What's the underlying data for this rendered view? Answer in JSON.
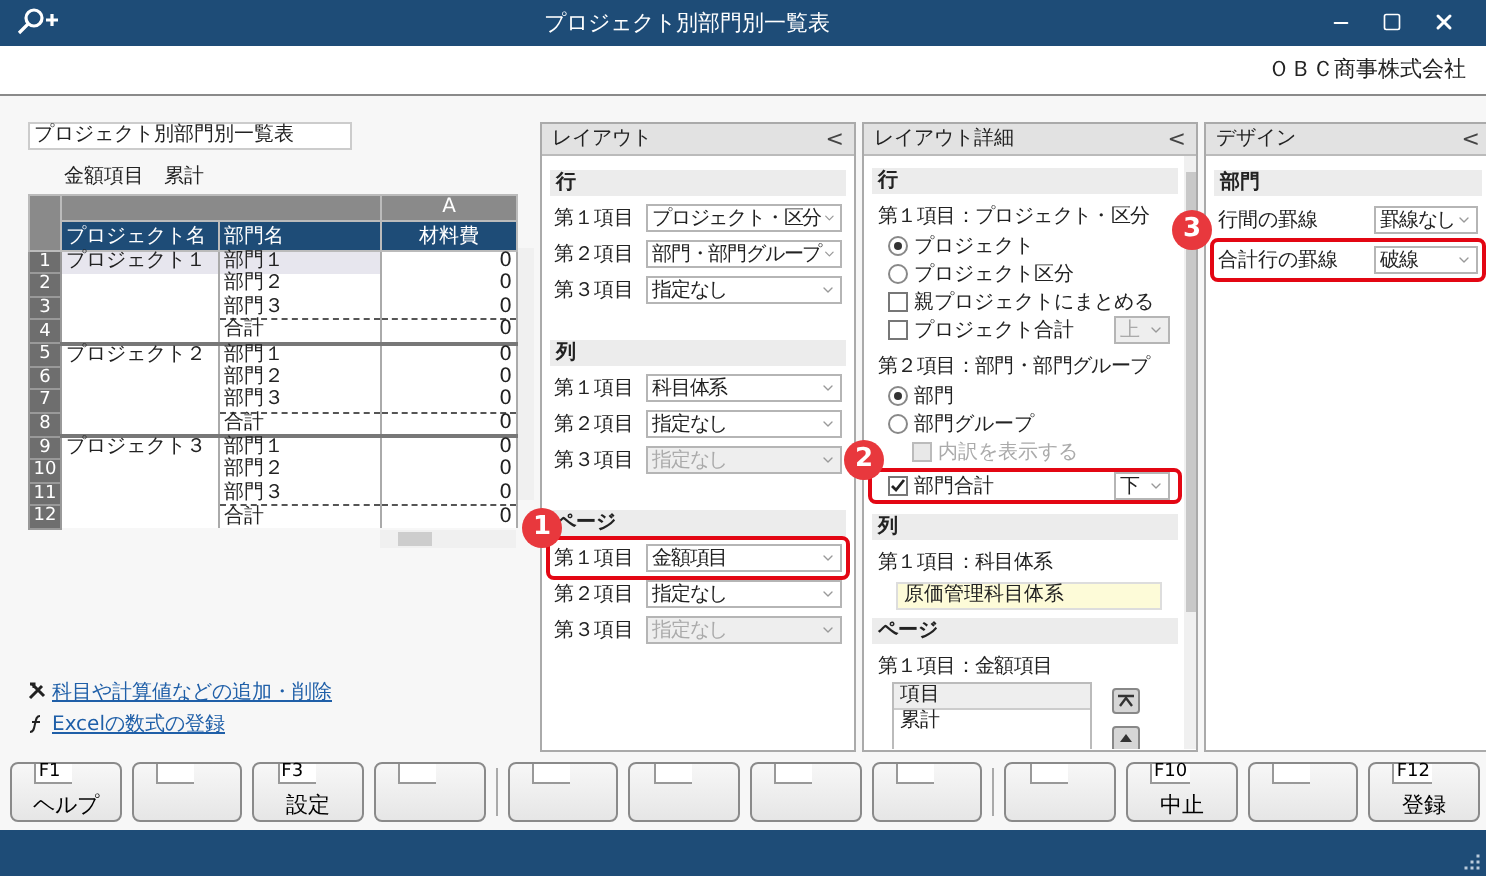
{
  "window": {
    "title": "プロジェクト別部門別一覧表",
    "company": "ＯＢＣ商事株式会社"
  },
  "report": {
    "title": "プロジェクト別部門別一覧表",
    "page_item": "金額項目",
    "page_value": "累計",
    "column_letter": "A",
    "columns": [
      "プロジェクト名",
      "部門名",
      "材料費"
    ],
    "rows": [
      {
        "number": "1",
        "project": "プロジェクト１",
        "department": "部門１",
        "amount": "0",
        "kind": "detail",
        "selected": true
      },
      {
        "number": "2",
        "department": "部門２",
        "amount": "0",
        "kind": "detail",
        "selected": false
      },
      {
        "number": "3",
        "department": "部門３",
        "amount": "0",
        "kind": "detail",
        "selected": false
      },
      {
        "number": "4",
        "department": "合計",
        "amount": "0",
        "kind": "total",
        "selected": false
      },
      {
        "number": "5",
        "project": "プロジェクト２",
        "department": "部門１",
        "amount": "0",
        "kind": "detail",
        "selected": false
      },
      {
        "number": "6",
        "department": "部門２",
        "amount": "0",
        "kind": "detail",
        "selected": false
      },
      {
        "number": "7",
        "department": "部門３",
        "amount": "0",
        "kind": "detail",
        "selected": false
      },
      {
        "number": "8",
        "department": "合計",
        "amount": "0",
        "kind": "total",
        "selected": false
      },
      {
        "number": "9",
        "project": "プロジェクト３",
        "department": "部門１",
        "amount": "0",
        "kind": "detail",
        "selected": false
      },
      {
        "number": "10",
        "department": "部門２",
        "amount": "0",
        "kind": "detail",
        "selected": false
      },
      {
        "number": "11",
        "department": "部門３",
        "amount": "0",
        "kind": "detail",
        "selected": false
      },
      {
        "number": "12",
        "department": "合計",
        "amount": "0",
        "kind": "total",
        "selected": false
      }
    ]
  },
  "links": [
    {
      "kind": "tool",
      "text": "科目や計算値などの追加・削除"
    },
    {
      "kind": "formula",
      "text": "Excelの数式の登録"
    }
  ],
  "layout_panel": {
    "title": "レイアウト",
    "collapse": "<",
    "sections": [
      {
        "title": "行",
        "items": [
          {
            "label": "第１項目",
            "value": "プロジェクト・区分",
            "disabled": false
          },
          {
            "label": "第２項目",
            "value": "部門・部門グループ",
            "disabled": false
          },
          {
            "label": "第３項目",
            "value": "指定なし",
            "disabled": false
          }
        ]
      },
      {
        "title": "列",
        "items": [
          {
            "label": "第１項目",
            "value": "科目体系",
            "disabled": false
          },
          {
            "label": "第２項目",
            "value": "指定なし",
            "disabled": false
          },
          {
            "label": "第３項目",
            "value": "指定なし",
            "disabled": true
          }
        ]
      },
      {
        "title": "ページ",
        "items": [
          {
            "label": "第１項目",
            "value": "金額項目",
            "disabled": false,
            "callout": "1"
          },
          {
            "label": "第２項目",
            "value": "指定なし",
            "disabled": false
          },
          {
            "label": "第３項目",
            "value": "指定なし",
            "disabled": true
          }
        ]
      }
    ]
  },
  "detail_panel": {
    "title": "レイアウト詳細",
    "collapse": "<",
    "sections": [
      {
        "title": "行",
        "items": [
          {
            "kind": "caption",
            "text": "第１項目：プロジェクト・区分"
          },
          {
            "kind": "radio",
            "label": "プロジェクト",
            "selected": true
          },
          {
            "kind": "radio",
            "label": "プロジェクト区分",
            "selected": false
          },
          {
            "kind": "checkbox",
            "label": "親プロジェクトにまとめる",
            "checked": false,
            "disabled": false
          },
          {
            "kind": "checkbox",
            "label": "プロジェクト合計",
            "checked": false,
            "disabled": false,
            "select": {
              "value": "上",
              "disabled": true
            }
          },
          {
            "kind": "caption",
            "text": "第２項目：部門・部門グループ"
          },
          {
            "kind": "radio",
            "label": "部門",
            "selected": true
          },
          {
            "kind": "radio",
            "label": "部門グループ",
            "selected": false,
            "children": [
              {
                "kind": "checkbox",
                "label": "内訳を表示する",
                "checked": false,
                "disabled": true
              }
            ]
          },
          {
            "kind": "checkbox",
            "label": "部門合計",
            "checked": true,
            "disabled": false,
            "select": {
              "value": "下",
              "disabled": false
            },
            "callout": "2"
          }
        ]
      },
      {
        "title": "列",
        "items": [
          {
            "kind": "caption",
            "text": "第１項目：科目体系"
          },
          {
            "kind": "field",
            "value": "原価管理科目体系"
          }
        ]
      },
      {
        "title": "ページ",
        "items": [
          {
            "kind": "caption",
            "text": "第１項目：金額項目"
          },
          {
            "kind": "list",
            "header": "項目",
            "rows": [
              "累計"
            ]
          }
        ]
      }
    ]
  },
  "design_panel": {
    "title": "デザイン",
    "collapse": "<",
    "sections": [
      {
        "title": "部門",
        "items": [
          {
            "label": "行間の罫線",
            "value": "罫線なし"
          },
          {
            "label": "合計行の罫線",
            "value": "破線",
            "callout": "3"
          }
        ]
      }
    ]
  },
  "function_keys": [
    [
      {
        "kind": "labeled",
        "key": "F1",
        "label": "ヘルプ"
      },
      {
        "kind": "blank"
      },
      {
        "kind": "labeled",
        "key": "F3",
        "label": "設定"
      },
      {
        "kind": "blank"
      }
    ],
    [
      {
        "kind": "blank"
      },
      {
        "kind": "blank"
      },
      {
        "kind": "blank"
      },
      {
        "kind": "blank"
      }
    ],
    [
      {
        "kind": "blank"
      },
      {
        "kind": "labeled",
        "key": "F10",
        "label": "中止"
      },
      {
        "kind": "blank"
      },
      {
        "kind": "labeled",
        "key": "F12",
        "label": "登録"
      }
    ]
  ]
}
